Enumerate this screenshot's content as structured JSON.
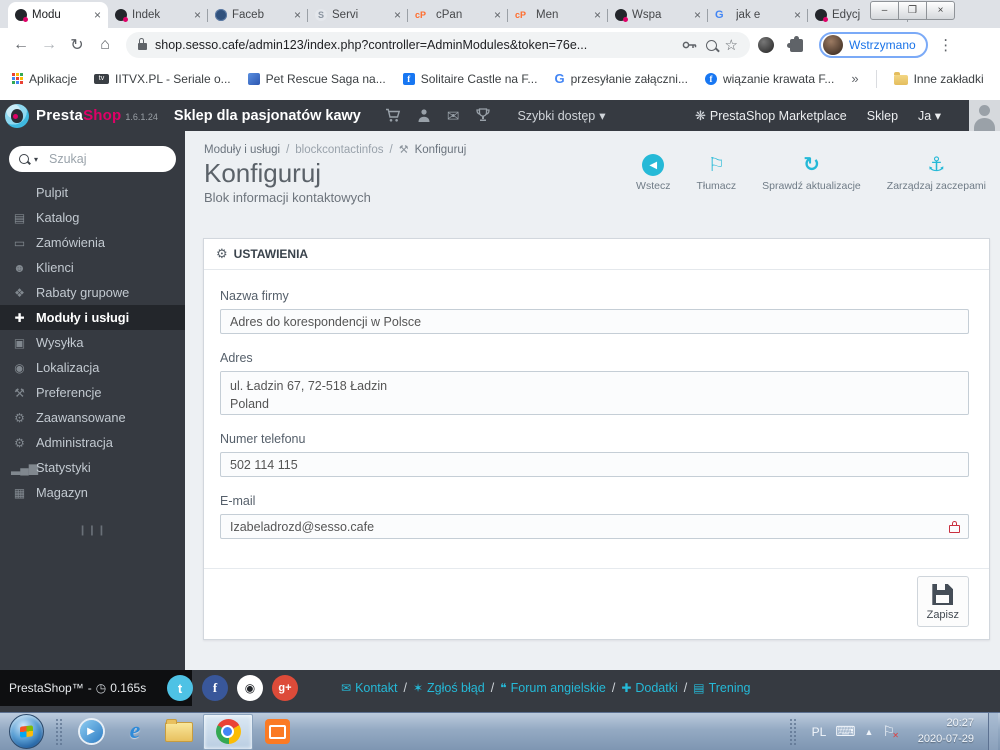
{
  "browser": {
    "tabs": [
      {
        "label": "Modu",
        "favicon": "prestashop"
      },
      {
        "label": "Indek",
        "favicon": "prestashop"
      },
      {
        "label": "Faceb",
        "favicon": "globe"
      },
      {
        "label": "Servi",
        "favicon": "s-circle"
      },
      {
        "label": "cPan",
        "favicon": "cpanel"
      },
      {
        "label": "Men",
        "favicon": "cpanel"
      },
      {
        "label": "Wspa",
        "favicon": "prestashop"
      },
      {
        "label": "jak e",
        "favicon": "google"
      },
      {
        "label": "Edycj",
        "favicon": "prestashop"
      }
    ],
    "url": "shop.sesso.cafe/admin123/index.php?controller=AdminModules&token=76e...",
    "profile_status": "Wstrzymano",
    "bookmarks": {
      "apps": "Aplikacje",
      "items": [
        "IITVX.PL - Seriale o...",
        "Pet Rescue Saga na...",
        "Solitaire Castle na F...",
        "przesyłanie załączni...",
        "wiązanie krawata  F..."
      ],
      "other": "Inne zakładki"
    }
  },
  "ps_header": {
    "brand_a": "Presta",
    "brand_b": "Shop",
    "version": "1.6.1.24",
    "shop_name": "Sklep dla pasjonatów kawy",
    "quick_access": "Szybki dostęp",
    "marketplace": "PrestaShop Marketplace",
    "shop_link": "Sklep",
    "user": "Ja"
  },
  "sidebar": {
    "search_placeholder": "Szukaj",
    "items": [
      {
        "label": "Pulpit",
        "icon": ""
      },
      {
        "label": "Katalog",
        "icon": "▤"
      },
      {
        "label": "Zamówienia",
        "icon": "▭"
      },
      {
        "label": "Klienci",
        "icon": "☻"
      },
      {
        "label": "Rabaty grupowe",
        "icon": "❖"
      },
      {
        "label": "Moduły i usługi",
        "icon": "✚"
      },
      {
        "label": "Wysyłka",
        "icon": "▣"
      },
      {
        "label": "Lokalizacja",
        "icon": "◉"
      },
      {
        "label": "Preferencje",
        "icon": "⚒"
      },
      {
        "label": "Zaawansowane",
        "icon": "⚙"
      },
      {
        "label": "Administracja",
        "icon": "⚙"
      },
      {
        "label": "Statystyki",
        "icon": "▂▄▆"
      },
      {
        "label": "Magazyn",
        "icon": "▦"
      }
    ]
  },
  "breadcrumb": [
    "Moduły i usługi",
    "blockcontactinfos",
    "Konfiguruj"
  ],
  "page": {
    "title": "Konfiguruj",
    "subtitle": "Blok informacji kontaktowych"
  },
  "toolbar": {
    "items": [
      {
        "label": "Wstecz"
      },
      {
        "label": "Tłumacz"
      },
      {
        "label": "Sprawdź aktualizacje"
      },
      {
        "label": "Zarządzaj zaczepami"
      }
    ]
  },
  "panel": {
    "heading": "USTAWIENIA",
    "fields": [
      {
        "label": "Nazwa firmy",
        "value": "Adres do korespondencji w Polsce"
      },
      {
        "label": "Adres",
        "value": "ul. Ładzin 67, 72-518 Ładzin\nPoland"
      },
      {
        "label": "Numer telefonu",
        "value": "502 114 115"
      },
      {
        "label": "E-mail",
        "value": "Izabeladrozd@sesso.cafe"
      }
    ],
    "save_label": "Zapisz"
  },
  "ps_footer": {
    "brand": "PrestaShop™",
    "dash": "-",
    "load_time": "0.165s",
    "socials": [
      {
        "name": "twitter",
        "glyph": "t"
      },
      {
        "name": "facebook",
        "glyph": "f"
      },
      {
        "name": "github",
        "glyph": "◉"
      },
      {
        "name": "google-plus",
        "glyph": "g+"
      }
    ],
    "links": [
      {
        "label": "Kontakt",
        "icon": "✉"
      },
      {
        "label": "Zgłoś błąd",
        "icon": "✶"
      },
      {
        "label": "Forum angielskie",
        "icon": "❝"
      },
      {
        "label": "Dodatki",
        "icon": "✚"
      },
      {
        "label": "Trening",
        "icon": "▤"
      }
    ],
    "separator": "/"
  },
  "taskbar": {
    "lang": "PL",
    "time": "20:27",
    "date": "2020-07-29"
  },
  "icons": {
    "close": "×",
    "new_tab": "+",
    "minimize": "–",
    "restore": "❐",
    "back": "←",
    "forward": "→",
    "reload": "↻",
    "home": "⌂",
    "star": "☆",
    "more": "⋮",
    "caret": "▾",
    "overflow": "»",
    "envelope": "✉",
    "flag": "⚐",
    "refresh": "↻",
    "anchor": "⚓",
    "wrench": "⚒",
    "gear": "⚙",
    "marketplace": "❋",
    "back_chevron": "◀",
    "grip": "❙❙❙",
    "clock": "◷",
    "tray_up": "▲",
    "keyboard": "⌨",
    "tray_flag": "⚐",
    "play": "▶",
    "slash": "/"
  },
  "colors": {
    "accent_teal": "#25b9d7",
    "brand_pink": "#df0067",
    "header_dark": "#363a41",
    "lock_red": "#c9303f",
    "profile_blue": "#1a73e8"
  }
}
